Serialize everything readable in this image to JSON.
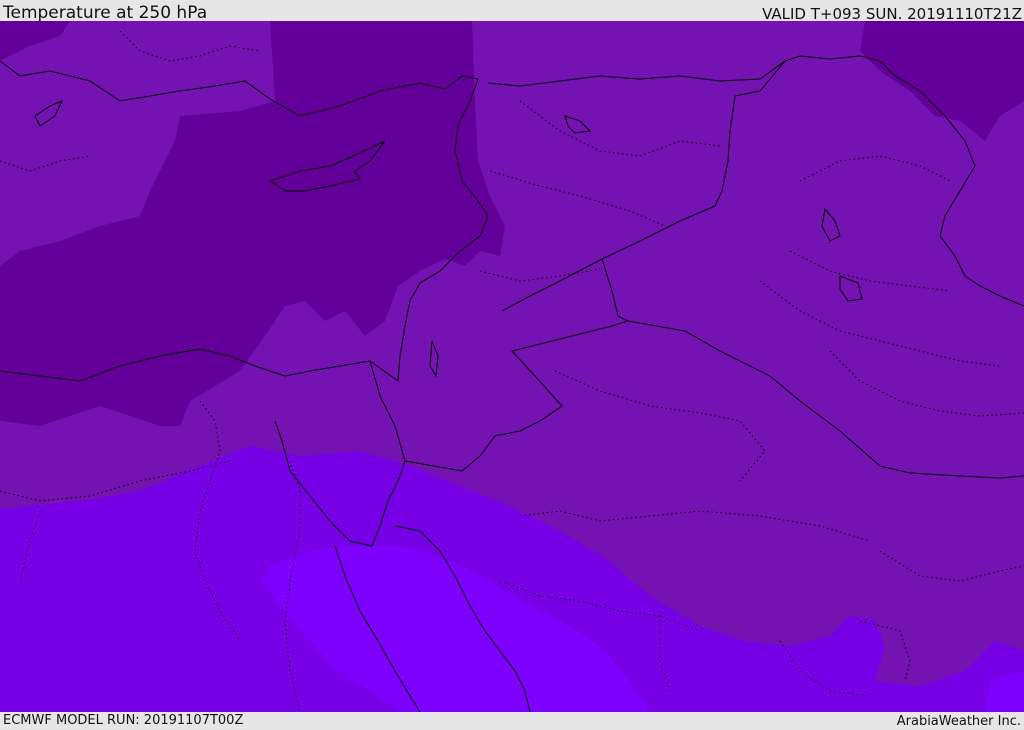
{
  "header": {
    "title": "Temperature at 250 hPa",
    "valid": "VALID T+093 SUN. 20191110T21Z"
  },
  "footer": {
    "run": "ECMWF MODEL RUN: 20191107T00Z",
    "credit": "ArabiaWeather Inc."
  },
  "colors": {
    "coldest": "#64009a",
    "cold": "#7513b2",
    "mid": "#7c0fc6",
    "warm": "#7800e6",
    "warmest": "#7e00ff",
    "border": "#000000"
  }
}
